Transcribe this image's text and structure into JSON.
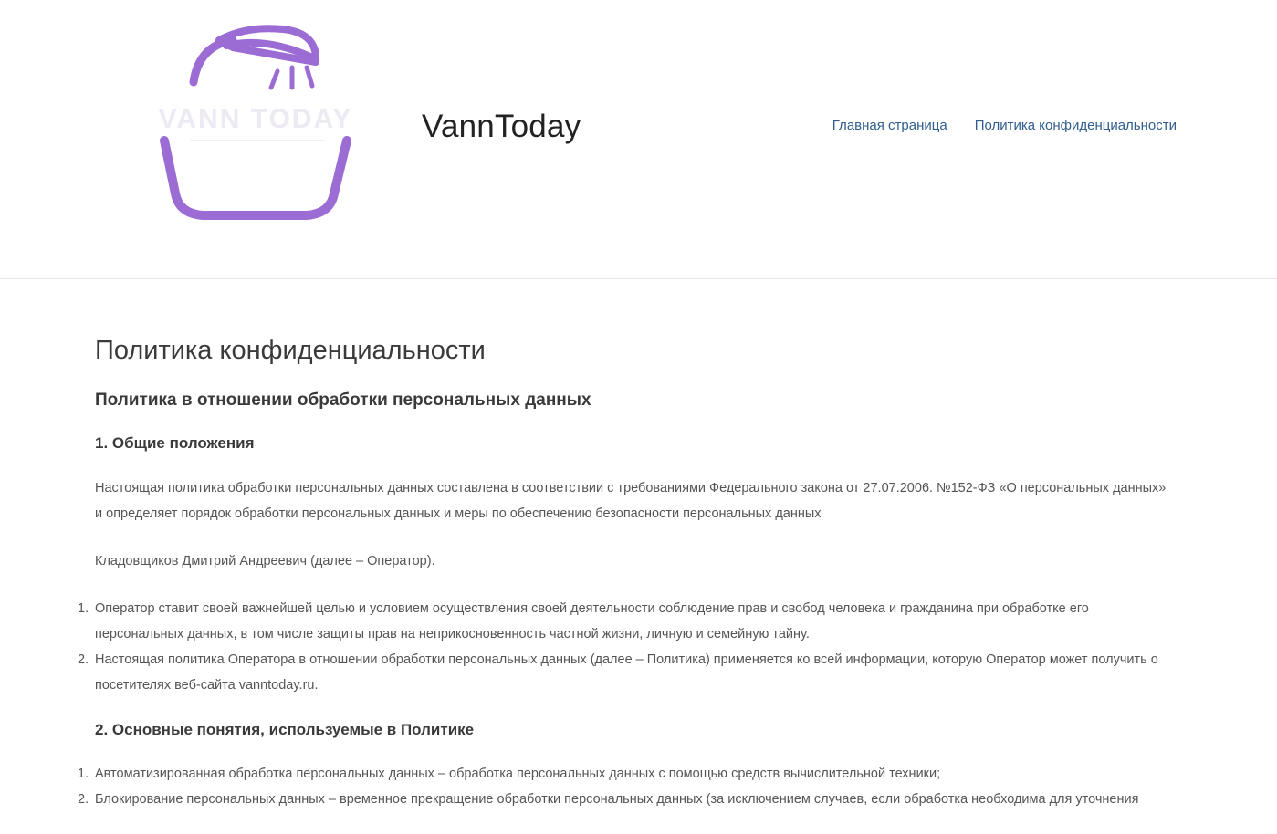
{
  "site": {
    "title": "VannToday",
    "logo_text": "VANN TODAY",
    "colors": {
      "logo_purple": "#9b6cd4",
      "link_blue": "#2e5d8e",
      "heading": "#3a3a3a",
      "body_text": "#555555"
    }
  },
  "nav": {
    "items": [
      {
        "label": "Главная страница"
      },
      {
        "label": "Политика конфиденциальности"
      }
    ]
  },
  "page": {
    "title": "Политика конфиденциальности",
    "heading": "Политика в отношении обработки персональных данных",
    "section1": {
      "title": "1. Общие положения",
      "intro_line1": "Настоящая политика обработки персональных данных составлена в соответствии с требованиями Федерального закона от 27.07.2006. №152-ФЗ «О персональных данных»",
      "intro_line2": "и определяет порядок обработки персональных данных и меры по обеспечению безопасности персональных данных",
      "operator": "Кладовщиков Дмитрий Андреевич (далее – Оператор).",
      "items": [
        {
          "num": "1.",
          "line1": "Оператор ставит своей важнейшей целью и условием осуществления своей деятельности соблюдение прав и свобод человека и гражданина при обработке его",
          "line2": "персональных данных, в том числе защиты прав на неприкосновенность частной жизни, личную и семейную тайну."
        },
        {
          "num": "2.",
          "line1": "Настоящая политика Оператора в отношении обработки персональных данных (далее – Политика) применяется ко всей информации, которую Оператор может получить о",
          "line2": "посетителях веб-сайта vanntoday.ru."
        }
      ]
    },
    "section2": {
      "title": "2. Основные понятия, используемые в Политике",
      "items": [
        {
          "num": "1.",
          "line1": "Автоматизированная обработка персональных данных – обработка персональных данных с помощью средств вычислительной техники;"
        },
        {
          "num": "2.",
          "line1": "Блокирование персональных данных – временное прекращение обработки персональных данных (за исключением случаев, если обработка необходима для уточнения"
        }
      ]
    }
  }
}
